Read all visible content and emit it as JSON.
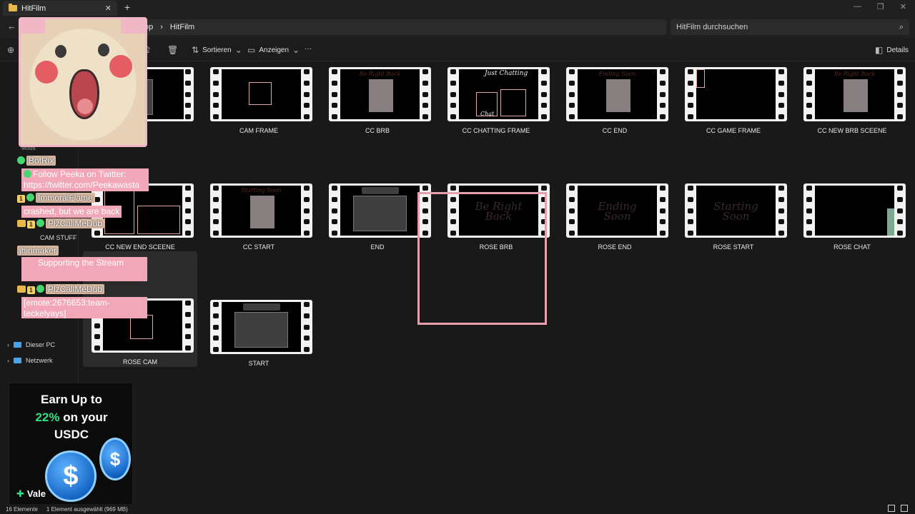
{
  "window": {
    "tab_title": "HitFilm",
    "tab_close": "✕",
    "tab_add": "+",
    "controls": [
      "—",
      "❐",
      "✕"
    ]
  },
  "address": {
    "crumb_partial": "op",
    "separator": "›",
    "current": "HitFilm",
    "search_placeholder": "HitFilm durchsuchen"
  },
  "toolbar": {
    "sort_label": "Sortieren",
    "view_label": "Anzeigen",
    "more_label": "···",
    "details_label": "Details"
  },
  "sidebar": {
    "items": [
      {
        "label": "Dieser PC"
      },
      {
        "label": "Netzwerk"
      },
      {
        "label": "CAM STUFF"
      },
      {
        "label": "Mods"
      }
    ]
  },
  "files": [
    {
      "name": "",
      "theme": "pink"
    },
    {
      "name": "CAM FRAME",
      "theme": "black"
    },
    {
      "name": "CC BRB",
      "theme": "cc",
      "thumb_title": "Be Right Back"
    },
    {
      "name": "CC CHATTING FRAME",
      "theme": "black",
      "thumb_title": "Just Chatting",
      "thumb_sub": "Chat"
    },
    {
      "name": "CC END",
      "theme": "cc",
      "thumb_title": "Ending Soon"
    },
    {
      "name": "CC GAME FRAME",
      "theme": "black"
    },
    {
      "name": "CC NEW BRB SCEENE",
      "theme": "cc",
      "thumb_title": "Be Right Back"
    },
    {
      "name": "CC NEW END SCEENE",
      "theme": "black"
    },
    {
      "name": "CC START",
      "theme": "cc",
      "thumb_title": "Starting Soon"
    },
    {
      "name": "END",
      "theme": "pink"
    },
    {
      "name": "ROSE BRB",
      "theme": "rose",
      "thumb_title": "Be Right Back"
    },
    {
      "name": "ROSE END",
      "theme": "rose",
      "thumb_title": "Ending Soon"
    },
    {
      "name": "ROSE START",
      "theme": "rose",
      "thumb_title": "Starting Soon"
    },
    {
      "name": "ROSE CHAT",
      "theme": "black"
    },
    {
      "name": "ROSE CAM",
      "theme": "black"
    },
    {
      "name": "START",
      "theme": "pink"
    }
  ],
  "chat": {
    "user1": "BotRix",
    "msg1a": "Follow Peeka on Twitter:",
    "msg1b": "https://twitter.com/Peekawasta",
    "user2": "ImmoralFlame",
    "msg2": "crashed, but we are back",
    "user3": "PlzCallMeDub",
    "user4": "jhinmaker",
    "msg4": "Supporting the Stream",
    "user5": "PlzCallMeDub",
    "msg5a": "[emote:2676653:team-",
    "msg5b": "teckelyays]",
    "badge_num": "1"
  },
  "ad": {
    "line1": "Earn Up to",
    "accent": "22%",
    "line2_rest": " on your",
    "line3": "USDC",
    "brand": "Vale",
    "coin_symbol": "$"
  },
  "status": {
    "count": "16 Elemente",
    "selected": "1 Element ausgewählt (969 MB)"
  },
  "colors": {
    "background": "#191919",
    "overlay_pink": "#f2a7b8",
    "accent_green": "#2fe27e",
    "folder_yellow": "#e8b84a"
  }
}
